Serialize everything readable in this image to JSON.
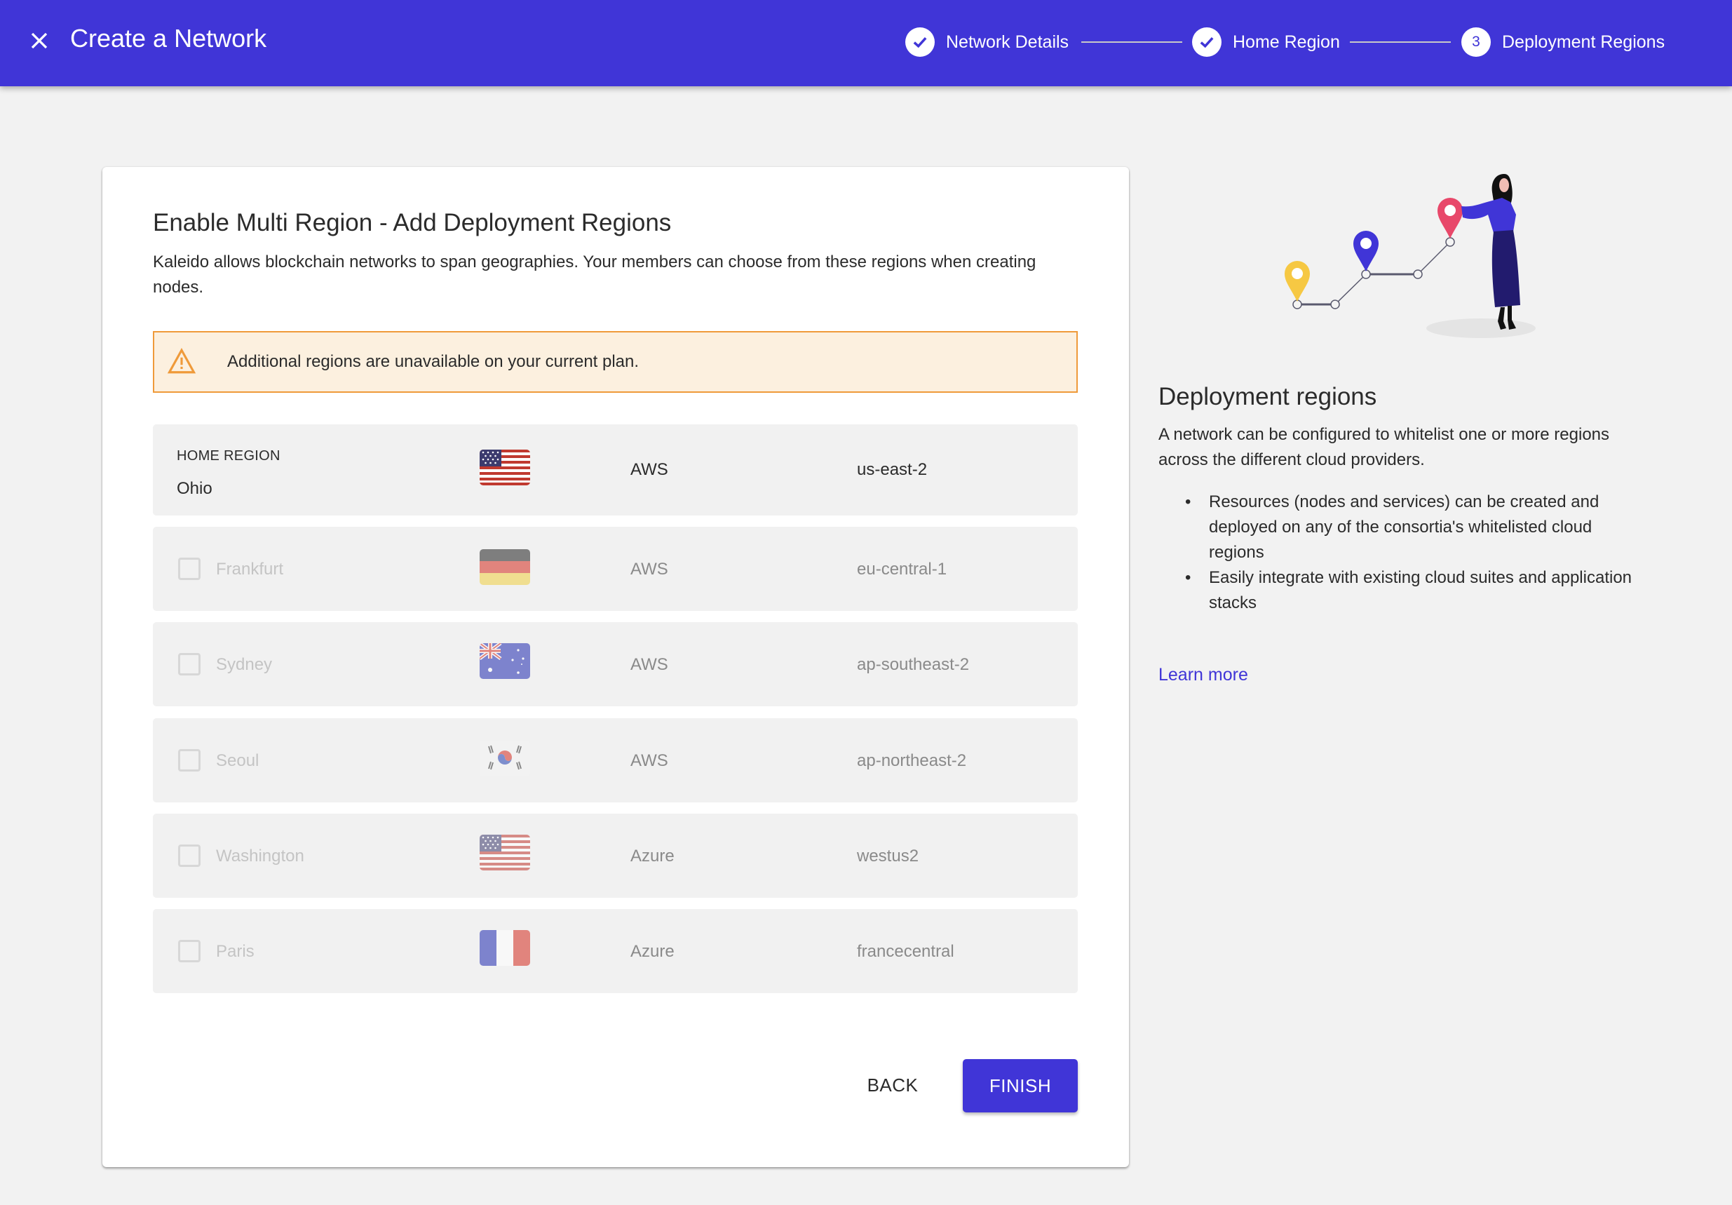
{
  "header": {
    "title": "Create a Network",
    "close_icon": "close-icon"
  },
  "stepper": {
    "steps": [
      {
        "label": "Network Details",
        "state": "completed",
        "icon": "check-circle-icon"
      },
      {
        "label": "Home Region",
        "state": "completed",
        "icon": "check-circle-icon"
      },
      {
        "label": "Deployment Regions",
        "state": "active",
        "number": "3"
      }
    ]
  },
  "main": {
    "title": "Enable Multi Region - Add Deployment Regions",
    "description": "Kaleido allows blockchain networks to span geographies. Your members can choose from these regions when creating nodes.",
    "warning": {
      "icon": "warning-icon",
      "text": "Additional regions are unavailable on your current plan."
    },
    "home_region": {
      "label": "HOME REGION",
      "name": "Ohio",
      "flag": "us",
      "provider": "AWS",
      "code": "us-east-2"
    },
    "regions": [
      {
        "name": "Frankfurt",
        "flag": "de",
        "provider": "AWS",
        "code": "eu-central-1",
        "checked": false,
        "disabled": true
      },
      {
        "name": "Sydney",
        "flag": "au",
        "provider": "AWS",
        "code": "ap-southeast-2",
        "checked": false,
        "disabled": true
      },
      {
        "name": "Seoul",
        "flag": "kr",
        "provider": "AWS",
        "code": "ap-northeast-2",
        "checked": false,
        "disabled": true
      },
      {
        "name": "Washington",
        "flag": "us",
        "provider": "Azure",
        "code": "westus2",
        "checked": false,
        "disabled": true
      },
      {
        "name": "Paris",
        "flag": "fr",
        "provider": "Azure",
        "code": "francecentral",
        "checked": false,
        "disabled": true
      }
    ],
    "back_label": "BACK",
    "finish_label": "FINISH"
  },
  "side": {
    "title": "Deployment regions",
    "description": "A network can be configured to whitelist one or more regions across the different cloud providers.",
    "bullets": [
      "Resources (nodes and services) can be created and deployed on any of the consortia's whitelisted cloud regions",
      "Easily integrate with existing cloud suites and application stacks"
    ],
    "learn_more": "Learn more"
  },
  "colors": {
    "primary": "#4035d7",
    "warning_border": "#ef9a3a",
    "warning_bg": "#fcf0df",
    "background": "#f2f2f2"
  }
}
